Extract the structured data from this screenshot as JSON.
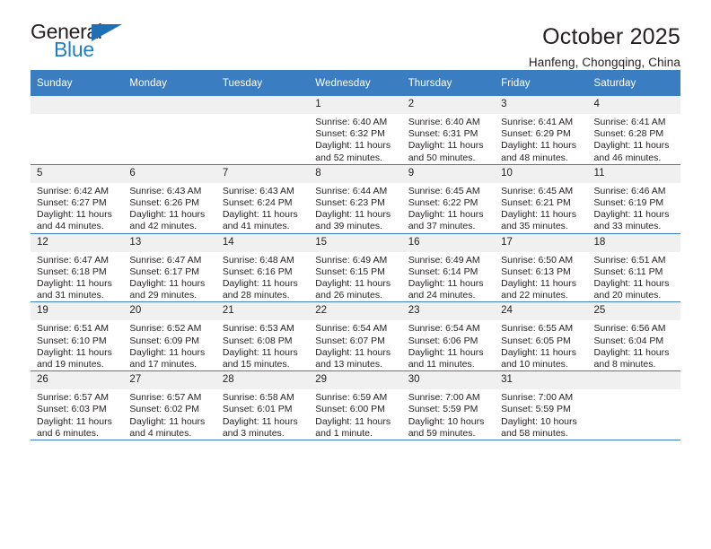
{
  "brand": {
    "name_top": "General",
    "name_bottom": "Blue",
    "accent_color": "#1f6fb4"
  },
  "header": {
    "title": "October 2025",
    "subtitle": "Hanfeng, Chongqing, China"
  },
  "calendar": {
    "header_bg": "#3a7dc0",
    "daycell_header_bg": "#f0f0f0",
    "weekdays": [
      "Sunday",
      "Monday",
      "Tuesday",
      "Wednesday",
      "Thursday",
      "Friday",
      "Saturday"
    ],
    "weeks": [
      [
        {
          "day": "",
          "empty": true
        },
        {
          "day": "",
          "empty": true
        },
        {
          "day": "",
          "empty": true
        },
        {
          "day": "1",
          "sunrise": "Sunrise: 6:40 AM",
          "sunset": "Sunset: 6:32 PM",
          "daylight1": "Daylight: 11 hours",
          "daylight2": "and 52 minutes."
        },
        {
          "day": "2",
          "sunrise": "Sunrise: 6:40 AM",
          "sunset": "Sunset: 6:31 PM",
          "daylight1": "Daylight: 11 hours",
          "daylight2": "and 50 minutes."
        },
        {
          "day": "3",
          "sunrise": "Sunrise: 6:41 AM",
          "sunset": "Sunset: 6:29 PM",
          "daylight1": "Daylight: 11 hours",
          "daylight2": "and 48 minutes."
        },
        {
          "day": "4",
          "sunrise": "Sunrise: 6:41 AM",
          "sunset": "Sunset: 6:28 PM",
          "daylight1": "Daylight: 11 hours",
          "daylight2": "and 46 minutes."
        }
      ],
      [
        {
          "day": "5",
          "sunrise": "Sunrise: 6:42 AM",
          "sunset": "Sunset: 6:27 PM",
          "daylight1": "Daylight: 11 hours",
          "daylight2": "and 44 minutes."
        },
        {
          "day": "6",
          "sunrise": "Sunrise: 6:43 AM",
          "sunset": "Sunset: 6:26 PM",
          "daylight1": "Daylight: 11 hours",
          "daylight2": "and 42 minutes."
        },
        {
          "day": "7",
          "sunrise": "Sunrise: 6:43 AM",
          "sunset": "Sunset: 6:24 PM",
          "daylight1": "Daylight: 11 hours",
          "daylight2": "and 41 minutes."
        },
        {
          "day": "8",
          "sunrise": "Sunrise: 6:44 AM",
          "sunset": "Sunset: 6:23 PM",
          "daylight1": "Daylight: 11 hours",
          "daylight2": "and 39 minutes."
        },
        {
          "day": "9",
          "sunrise": "Sunrise: 6:45 AM",
          "sunset": "Sunset: 6:22 PM",
          "daylight1": "Daylight: 11 hours",
          "daylight2": "and 37 minutes."
        },
        {
          "day": "10",
          "sunrise": "Sunrise: 6:45 AM",
          "sunset": "Sunset: 6:21 PM",
          "daylight1": "Daylight: 11 hours",
          "daylight2": "and 35 minutes."
        },
        {
          "day": "11",
          "sunrise": "Sunrise: 6:46 AM",
          "sunset": "Sunset: 6:19 PM",
          "daylight1": "Daylight: 11 hours",
          "daylight2": "and 33 minutes."
        }
      ],
      [
        {
          "day": "12",
          "sunrise": "Sunrise: 6:47 AM",
          "sunset": "Sunset: 6:18 PM",
          "daylight1": "Daylight: 11 hours",
          "daylight2": "and 31 minutes."
        },
        {
          "day": "13",
          "sunrise": "Sunrise: 6:47 AM",
          "sunset": "Sunset: 6:17 PM",
          "daylight1": "Daylight: 11 hours",
          "daylight2": "and 29 minutes."
        },
        {
          "day": "14",
          "sunrise": "Sunrise: 6:48 AM",
          "sunset": "Sunset: 6:16 PM",
          "daylight1": "Daylight: 11 hours",
          "daylight2": "and 28 minutes."
        },
        {
          "day": "15",
          "sunrise": "Sunrise: 6:49 AM",
          "sunset": "Sunset: 6:15 PM",
          "daylight1": "Daylight: 11 hours",
          "daylight2": "and 26 minutes."
        },
        {
          "day": "16",
          "sunrise": "Sunrise: 6:49 AM",
          "sunset": "Sunset: 6:14 PM",
          "daylight1": "Daylight: 11 hours",
          "daylight2": "and 24 minutes."
        },
        {
          "day": "17",
          "sunrise": "Sunrise: 6:50 AM",
          "sunset": "Sunset: 6:13 PM",
          "daylight1": "Daylight: 11 hours",
          "daylight2": "and 22 minutes."
        },
        {
          "day": "18",
          "sunrise": "Sunrise: 6:51 AM",
          "sunset": "Sunset: 6:11 PM",
          "daylight1": "Daylight: 11 hours",
          "daylight2": "and 20 minutes."
        }
      ],
      [
        {
          "day": "19",
          "sunrise": "Sunrise: 6:51 AM",
          "sunset": "Sunset: 6:10 PM",
          "daylight1": "Daylight: 11 hours",
          "daylight2": "and 19 minutes."
        },
        {
          "day": "20",
          "sunrise": "Sunrise: 6:52 AM",
          "sunset": "Sunset: 6:09 PM",
          "daylight1": "Daylight: 11 hours",
          "daylight2": "and 17 minutes."
        },
        {
          "day": "21",
          "sunrise": "Sunrise: 6:53 AM",
          "sunset": "Sunset: 6:08 PM",
          "daylight1": "Daylight: 11 hours",
          "daylight2": "and 15 minutes."
        },
        {
          "day": "22",
          "sunrise": "Sunrise: 6:54 AM",
          "sunset": "Sunset: 6:07 PM",
          "daylight1": "Daylight: 11 hours",
          "daylight2": "and 13 minutes."
        },
        {
          "day": "23",
          "sunrise": "Sunrise: 6:54 AM",
          "sunset": "Sunset: 6:06 PM",
          "daylight1": "Daylight: 11 hours",
          "daylight2": "and 11 minutes."
        },
        {
          "day": "24",
          "sunrise": "Sunrise: 6:55 AM",
          "sunset": "Sunset: 6:05 PM",
          "daylight1": "Daylight: 11 hours",
          "daylight2": "and 10 minutes."
        },
        {
          "day": "25",
          "sunrise": "Sunrise: 6:56 AM",
          "sunset": "Sunset: 6:04 PM",
          "daylight1": "Daylight: 11 hours",
          "daylight2": "and 8 minutes."
        }
      ],
      [
        {
          "day": "26",
          "sunrise": "Sunrise: 6:57 AM",
          "sunset": "Sunset: 6:03 PM",
          "daylight1": "Daylight: 11 hours",
          "daylight2": "and 6 minutes."
        },
        {
          "day": "27",
          "sunrise": "Sunrise: 6:57 AM",
          "sunset": "Sunset: 6:02 PM",
          "daylight1": "Daylight: 11 hours",
          "daylight2": "and 4 minutes."
        },
        {
          "day": "28",
          "sunrise": "Sunrise: 6:58 AM",
          "sunset": "Sunset: 6:01 PM",
          "daylight1": "Daylight: 11 hours",
          "daylight2": "and 3 minutes."
        },
        {
          "day": "29",
          "sunrise": "Sunrise: 6:59 AM",
          "sunset": "Sunset: 6:00 PM",
          "daylight1": "Daylight: 11 hours",
          "daylight2": "and 1 minute."
        },
        {
          "day": "30",
          "sunrise": "Sunrise: 7:00 AM",
          "sunset": "Sunset: 5:59 PM",
          "daylight1": "Daylight: 10 hours",
          "daylight2": "and 59 minutes."
        },
        {
          "day": "31",
          "sunrise": "Sunrise: 7:00 AM",
          "sunset": "Sunset: 5:59 PM",
          "daylight1": "Daylight: 10 hours",
          "daylight2": "and 58 minutes."
        },
        {
          "day": "",
          "empty": true
        }
      ]
    ]
  }
}
